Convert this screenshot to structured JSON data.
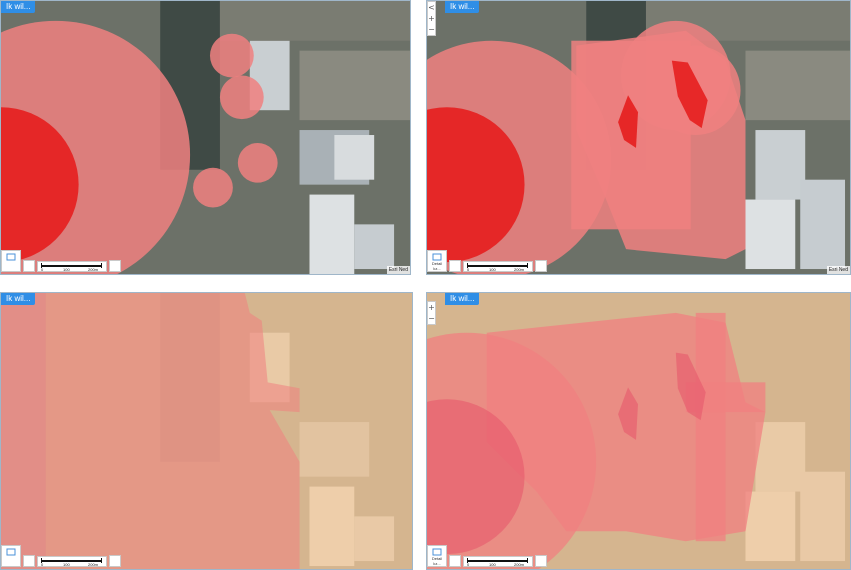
{
  "panels": [
    {
      "id": "top-left",
      "menu_label": "Ik wil...",
      "show_zoom": false,
      "show_attribution": true,
      "attribution": "Esri Ned",
      "legend_text": ""
    },
    {
      "id": "top-right",
      "menu_label": "Ik wil...",
      "show_zoom": true,
      "show_attribution": true,
      "attribution": "Esri Ned",
      "legend_text": "Detail kz..."
    },
    {
      "id": "bottom-left",
      "menu_label": "Ik wil...",
      "show_zoom": false,
      "show_attribution": false,
      "attribution": "",
      "legend_text": ""
    },
    {
      "id": "bottom-right",
      "menu_label": "Ik wil...",
      "show_zoom": true,
      "show_attribution": false,
      "attribution": "",
      "legend_text": "Detail kz..."
    }
  ],
  "zoom": {
    "back": "<",
    "in": "+",
    "out": "−"
  },
  "scalebar": {
    "labels": [
      "0",
      "100",
      "200m"
    ]
  },
  "overlay_colors": {
    "high_risk": "#e61e1e",
    "medium_risk": "#f08080",
    "zone_orange": "#f2c89a",
    "water": "#3f4a45"
  }
}
